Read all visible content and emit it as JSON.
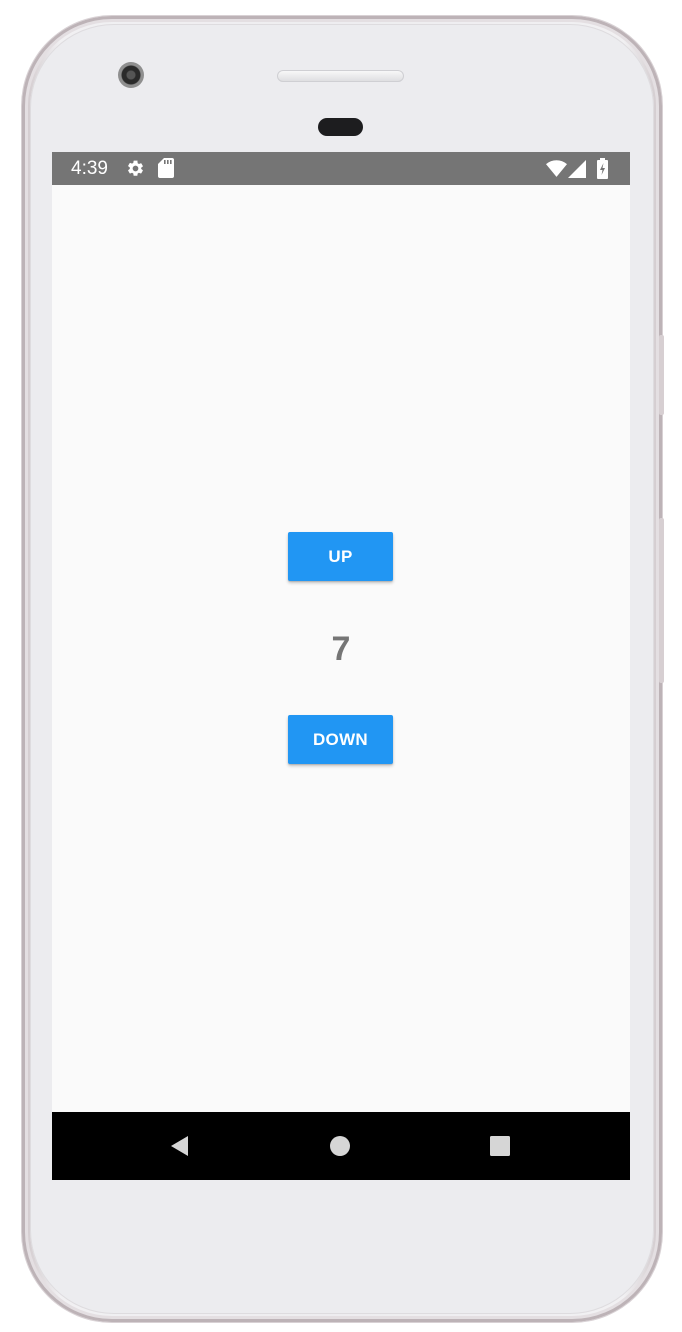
{
  "status_bar": {
    "time": "4:39",
    "icons": [
      "gear-icon",
      "sd-card-icon",
      "wifi-icon",
      "signal-icon",
      "battery-charging-icon"
    ]
  },
  "app": {
    "up_label": "UP",
    "counter_value": "7",
    "down_label": "DOWN",
    "accent_color": "#2196f3",
    "counter_color": "#757575"
  },
  "nav_bar": {
    "icons": [
      "back-icon",
      "home-icon",
      "recents-icon"
    ]
  }
}
